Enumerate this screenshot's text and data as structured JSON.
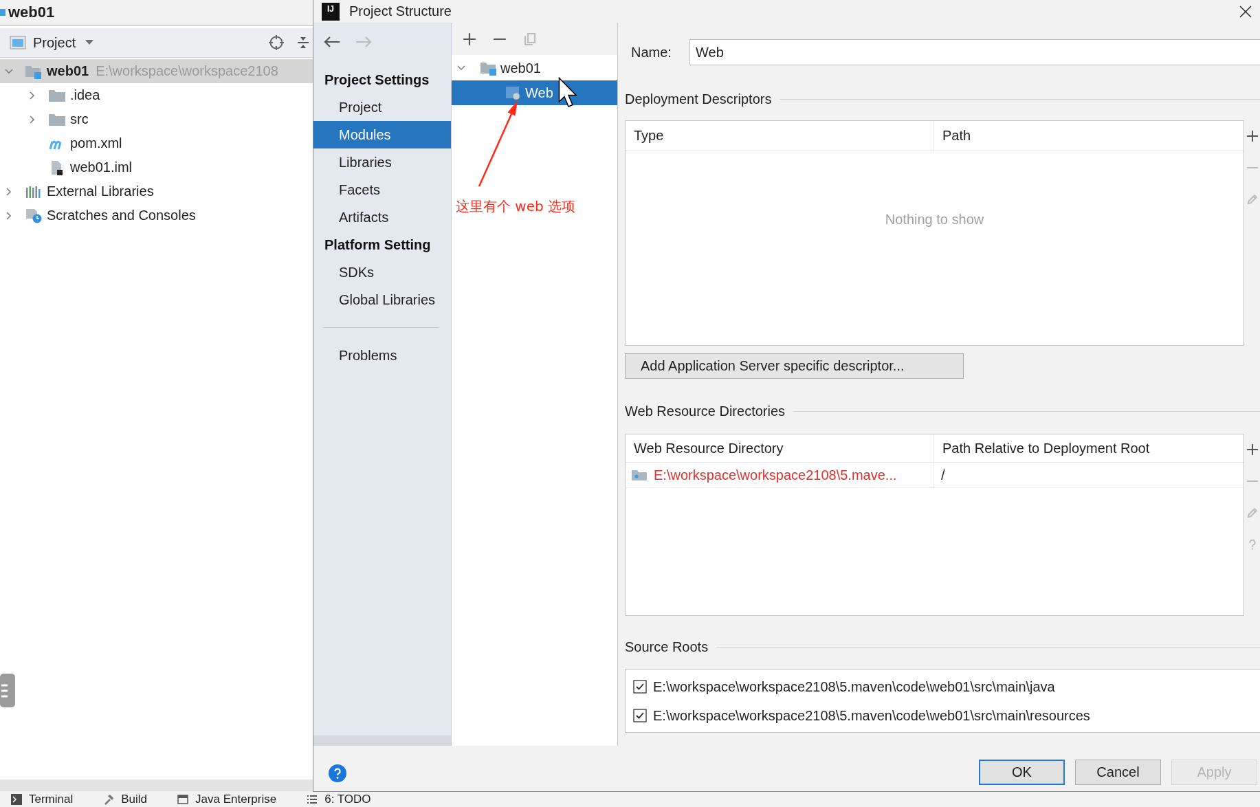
{
  "ide": {
    "breadcrumb": "web01",
    "tool_window": {
      "title": "Project"
    },
    "tree": [
      {
        "label": "web01",
        "kind": "module",
        "path": "E:\\workspace\\workspace2108",
        "expanded": true,
        "selected": true,
        "children": [
          {
            "label": ".idea",
            "kind": "folder",
            "expanded": false,
            "selected": false
          },
          {
            "label": "src",
            "kind": "folder",
            "expanded": false,
            "selected": false
          },
          {
            "label": "pom.xml",
            "kind": "maven",
            "selected": false
          },
          {
            "label": "web01.iml",
            "kind": "iml",
            "selected": false
          }
        ]
      },
      {
        "label": "External Libraries",
        "kind": "libraries",
        "expanded": false,
        "selected": false
      },
      {
        "label": "Scratches and Consoles",
        "kind": "scratches",
        "expanded": false,
        "selected": false
      }
    ],
    "tool_tabs": [
      {
        "label": "Terminal",
        "kind": "terminal"
      },
      {
        "label": "Build",
        "kind": "build"
      },
      {
        "label": "Java Enterprise",
        "kind": "enterprise"
      },
      {
        "label": "6: TODO",
        "kind": "todo"
      }
    ]
  },
  "dialog": {
    "logo": "IJ",
    "title": "Project Structure",
    "history": [
      {
        "kind": "back",
        "disabled": false
      },
      {
        "kind": "forward",
        "disabled": true
      }
    ],
    "nav_groups": [
      {
        "heading": "Project Settings",
        "items": [
          {
            "label": "Project",
            "selected": false
          },
          {
            "label": "Modules",
            "selected": true
          },
          {
            "label": "Libraries",
            "selected": false
          },
          {
            "label": "Facets",
            "selected": false
          },
          {
            "label": "Artifacts",
            "selected": false
          }
        ]
      },
      {
        "heading": "Platform Setting",
        "items": [
          {
            "label": "SDKs",
            "selected": false
          },
          {
            "label": "Global Libraries",
            "selected": false
          }
        ]
      },
      {
        "items": [
          {
            "label": "Problems",
            "selected": false
          }
        ]
      }
    ],
    "module_toolbar": [
      {
        "kind": "add",
        "disabled": false
      },
      {
        "kind": "remove",
        "disabled": false
      },
      {
        "kind": "copy",
        "disabled": true
      }
    ],
    "module_tree": [
      {
        "label": "web01",
        "kind": "module",
        "expanded": true,
        "selected": false,
        "children": [
          {
            "label": "Web",
            "kind": "web",
            "selected": true
          }
        ]
      }
    ],
    "annotation": "这里有个 web 选项",
    "name_field": {
      "label": "Name:",
      "value": "Web"
    },
    "deployment_descriptors": {
      "title": "Deployment Descriptors",
      "columns": [
        "Type",
        "Path"
      ],
      "empty_text": "Nothing to show",
      "side_tools": [
        {
          "kind": "add",
          "disabled": false
        },
        {
          "kind": "remove",
          "disabled": true
        },
        {
          "kind": "edit",
          "disabled": true
        }
      ],
      "add_button": "Add Application Server specific descriptor..."
    },
    "web_resource_directories": {
      "title": "Web Resource Directories",
      "columns": [
        "Web Resource Directory",
        "Path Relative to Deployment Root"
      ],
      "rows": [
        {
          "directory": "E:\\workspace\\workspace2108\\5.mave...",
          "relative_path": "/",
          "missing": true
        }
      ],
      "side_tools": [
        {
          "kind": "add",
          "disabled": false
        },
        {
          "kind": "remove",
          "disabled": true
        },
        {
          "kind": "edit",
          "disabled": true
        },
        {
          "kind": "help",
          "disabled": true
        }
      ]
    },
    "source_roots": {
      "title": "Source Roots",
      "items": [
        {
          "path": "E:\\workspace\\workspace2108\\5.maven\\code\\web01\\src\\main\\java",
          "checked": true
        },
        {
          "path": "E:\\workspace\\workspace2108\\5.maven\\code\\web01\\src\\main\\resources",
          "checked": true
        }
      ]
    },
    "buttons": [
      {
        "label": "OK",
        "focused": true,
        "disabled": false
      },
      {
        "label": "Cancel",
        "focused": false,
        "disabled": false
      },
      {
        "label": "Apply",
        "focused": false,
        "disabled": true
      }
    ]
  }
}
